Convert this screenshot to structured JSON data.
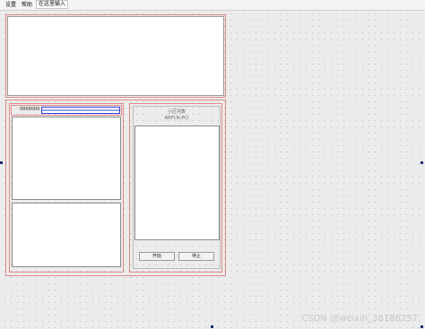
{
  "menubar": {
    "items": [
      "设置",
      "帮助"
    ],
    "add_item": "在这里输入"
  },
  "left_panel": {
    "combo_value": "0000000"
  },
  "cell_list": {
    "title_line1": "小区列表",
    "title_line2": "ARFCN-PCI"
  },
  "buttons": {
    "start": "开始",
    "stop": "停止"
  },
  "watermark": "CSDN @weixin_38186257"
}
